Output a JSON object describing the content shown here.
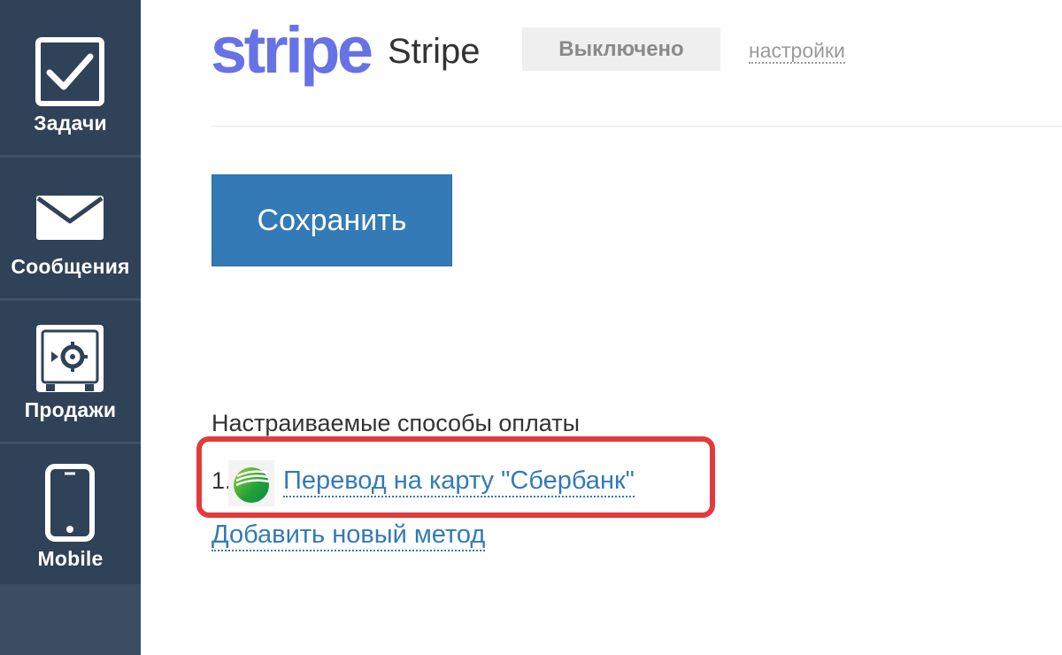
{
  "sidebar": {
    "items": [
      {
        "label": "Задачи",
        "icon": "checkbox-icon"
      },
      {
        "label": "Сообщения",
        "icon": "envelope-icon"
      },
      {
        "label": "Продажи",
        "icon": "safe-icon"
      },
      {
        "label": "Mobile",
        "icon": "smartphone-icon"
      }
    ]
  },
  "provider": {
    "logo_text": "stripe",
    "name": "Stripe",
    "status": "Выключено",
    "settings_label": "настройки"
  },
  "actions": {
    "save_label": "Сохранить"
  },
  "payment_methods": {
    "title": "Настраиваемые способы оплаты",
    "items": [
      {
        "index": "1.",
        "label": "Перевод на карту \"Сбербанк\"",
        "icon": "sberbank-icon"
      }
    ],
    "add_label": "Добавить новый метод"
  },
  "colors": {
    "sidebar": "#2f4257",
    "stripe_brand": "#6772e5",
    "primary_button": "#337ab7",
    "link": "#337ab7",
    "highlight": "#e23b3b"
  }
}
